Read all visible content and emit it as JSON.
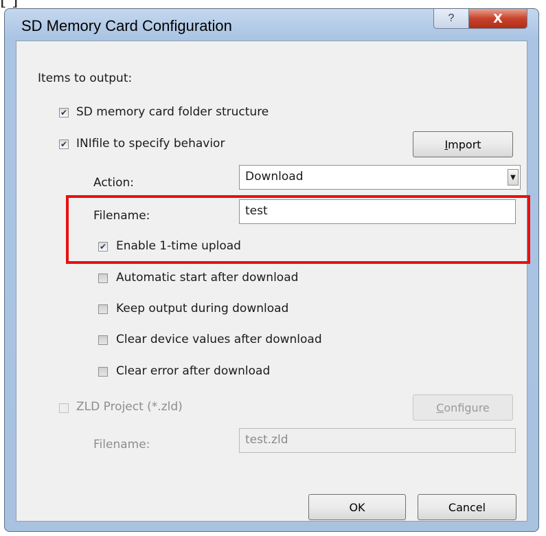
{
  "window": {
    "title": "SD Memory Card Configuration",
    "help_glyph": "?",
    "close_glyph": "X"
  },
  "items_label": "Items to output:",
  "options": {
    "folder_structure": {
      "label": "SD memory card folder structure",
      "checked": true
    },
    "ini_file": {
      "label": "INIfile to specify behavior",
      "checked": true
    },
    "import_button": {
      "prefix": "",
      "accel": "I",
      "suffix": "mport"
    },
    "action_label": "Action:",
    "action_value": "Download",
    "filename_label": "Filename:",
    "filename_value": "test",
    "enable_upload": {
      "label": "Enable 1-time upload",
      "checked": true
    },
    "auto_start": {
      "label": "Automatic start after download",
      "checked": false
    },
    "keep_output": {
      "label": "Keep output during download",
      "checked": false
    },
    "clear_device": {
      "label": "Clear device values after download",
      "checked": false
    },
    "clear_error": {
      "label": "Clear error after download",
      "checked": false
    }
  },
  "zld": {
    "label": "ZLD Project (*.zld)",
    "checked": false,
    "configure_button": {
      "accel": "C",
      "suffix": "onfigure"
    },
    "filename_label": "Filename:",
    "filename_value": "test.zld"
  },
  "footer": {
    "ok_label": "OK",
    "cancel_label": "Cancel"
  },
  "cropped_text": "[ ]                ",
  "colors": {
    "highlight": "#e81010",
    "close_button": "#c7422b",
    "title_gradient": "#c4d8ee"
  }
}
